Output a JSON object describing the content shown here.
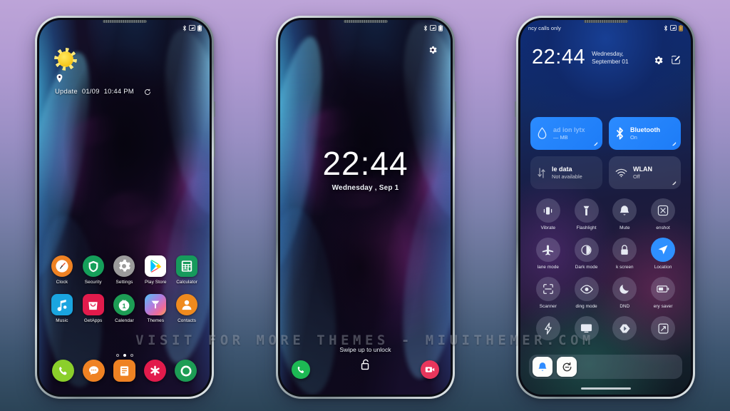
{
  "background": {
    "top_color": "#bda4d8",
    "bottom_color": "#2b4457"
  },
  "watermark": {
    "text": "VISIT FOR MORE THEMES - MIUITHEMER.COM"
  },
  "phone1": {
    "name": "home-screen",
    "statusbar": {
      "icons": [
        "bluetooth-icon",
        "sim-icon",
        "battery-icon"
      ]
    },
    "widget": {
      "weather_icon": "sun-icon",
      "location_icon": "location-pin-icon",
      "update_label": "Update",
      "date": "01/09",
      "time": "10:44 PM",
      "refresh_icon": "refresh-icon"
    },
    "apps": [
      {
        "label": "Clock",
        "icon": "clock-icon",
        "bg": "#ef8223"
      },
      {
        "label": "Security",
        "icon": "shield-icon",
        "bg": "#159f5a"
      },
      {
        "label": "Settings",
        "icon": "gear-icon",
        "bg": "#9b9b9b"
      },
      {
        "label": "Play Store",
        "icon": "play-store-icon",
        "bg": "#ffffff"
      },
      {
        "label": "Calculator",
        "icon": "calculator-icon",
        "bg": "#169a5c"
      },
      {
        "label": "Music",
        "icon": "music-note-icon",
        "bg": "#1aa5e0"
      },
      {
        "label": "GetApps",
        "icon": "bag-icon",
        "bg": "#e21b4c"
      },
      {
        "label": "Calendar",
        "icon": "calendar-icon",
        "bg": "#1d9d55"
      },
      {
        "label": "Themes",
        "icon": "brush-icon",
        "bg": "#c56ed0"
      },
      {
        "label": "Contacts",
        "icon": "person-icon",
        "bg": "#ef8a1e"
      }
    ],
    "page_dots": {
      "count": 3,
      "active_index": 1
    },
    "dock": [
      {
        "icon": "phone-icon",
        "bg": "#8bcf2b"
      },
      {
        "icon": "messages-icon",
        "bg": "#ef8223"
      },
      {
        "icon": "notes-icon",
        "bg": "#ef8223"
      },
      {
        "icon": "asterisk-icon",
        "bg": "#e21b4c"
      },
      {
        "icon": "browser-icon",
        "bg": "#1d9d55"
      }
    ]
  },
  "phone2": {
    "name": "lock-screen",
    "statusbar": {
      "icons": [
        "bluetooth-icon",
        "sim-icon",
        "battery-icon"
      ]
    },
    "settings_icon": "gear-icon",
    "time": "22:44",
    "date": "Wednesday , Sep 1",
    "hint": "Swipe up to unlock",
    "unlock_icon": "unlock-icon",
    "shortcut_left": {
      "icon": "phone-icon",
      "bg": "#1db954"
    },
    "shortcut_right": {
      "icon": "camera-icon",
      "bg": "#e8365c"
    }
  },
  "phone3": {
    "name": "control-center",
    "statusbar": {
      "carrier": "ncy calls only",
      "icons": [
        "bluetooth-icon",
        "sim-icon",
        "battery-icon"
      ]
    },
    "time": "22:44",
    "date_line1": "Wednesday,",
    "date_line2": "September 01",
    "header_icons": [
      "gear-icon",
      "edit-icon"
    ],
    "tiles": [
      {
        "title": "ad ion lytx",
        "subtitle": "— MB",
        "icon": "data-drop-icon",
        "state": "on"
      },
      {
        "title": "Bluetooth",
        "subtitle": "On",
        "icon": "bluetooth-icon",
        "state": "on"
      },
      {
        "title": "le data",
        "subtitle": "Not available",
        "icon": "mobile-data-icon",
        "state": "off-dim"
      },
      {
        "title": "WLAN",
        "subtitle": "Off",
        "icon": "wifi-icon",
        "state": "off"
      }
    ],
    "quick_settings": [
      {
        "label": "Vibrate",
        "icon": "vibrate-icon",
        "active": false
      },
      {
        "label": "Flashlight",
        "icon": "flashlight-icon",
        "active": false
      },
      {
        "label": "Mute",
        "icon": "bell-icon",
        "active": false
      },
      {
        "label": "enshot",
        "icon": "screenshot-icon",
        "active": false
      },
      {
        "label": "lane mode",
        "icon": "airplane-icon",
        "active": false
      },
      {
        "label": "Dark mode",
        "icon": "contrast-icon",
        "active": false
      },
      {
        "label": "k screen",
        "icon": "lock-icon",
        "active": false
      },
      {
        "label": "Location",
        "icon": "navigation-icon",
        "active": true
      },
      {
        "label": "Scanner",
        "icon": "scan-icon",
        "active": false
      },
      {
        "label": "ding mode",
        "icon": "eye-icon",
        "active": false
      },
      {
        "label": "DND",
        "icon": "moon-icon",
        "active": false
      },
      {
        "label": "ery saver",
        "icon": "battery-icon",
        "active": false
      },
      {
        "label": "",
        "icon": "bolt-icon",
        "active": false
      },
      {
        "label": "",
        "icon": "cast-icon",
        "active": false
      },
      {
        "label": "",
        "icon": "nfc-icon",
        "active": false
      },
      {
        "label": "",
        "icon": "resize-icon",
        "active": false
      }
    ],
    "notification_apps": [
      {
        "icon": "notify-bell-icon"
      },
      {
        "icon": "sync-icon"
      }
    ]
  }
}
